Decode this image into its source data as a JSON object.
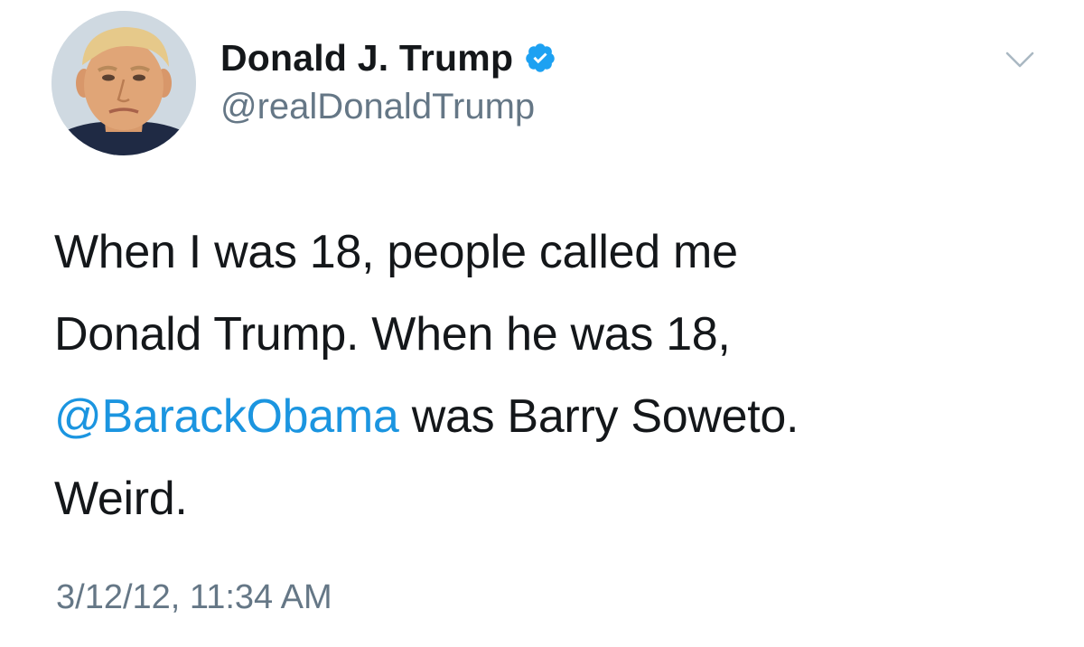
{
  "tweet": {
    "author": {
      "display_name": "Donald J. Trump",
      "handle": "@realDonaldTrump",
      "verified": true,
      "verified_icon": "verified-badge-icon"
    },
    "menu_icon": "chevron-down-icon",
    "text": {
      "line1": "When I was 18, people called me",
      "line2": "Donald Trump. When he was 18,",
      "line3_mention": "@BarackObama",
      "line3_rest": " was Barry Soweto.",
      "line4": "Weird."
    },
    "timestamp": "3/12/12, 11:34 AM"
  },
  "colors": {
    "text": "#14171a",
    "secondary": "#657786",
    "link": "#1b95e0",
    "verified": "#1da1f2",
    "background": "#ffffff"
  }
}
